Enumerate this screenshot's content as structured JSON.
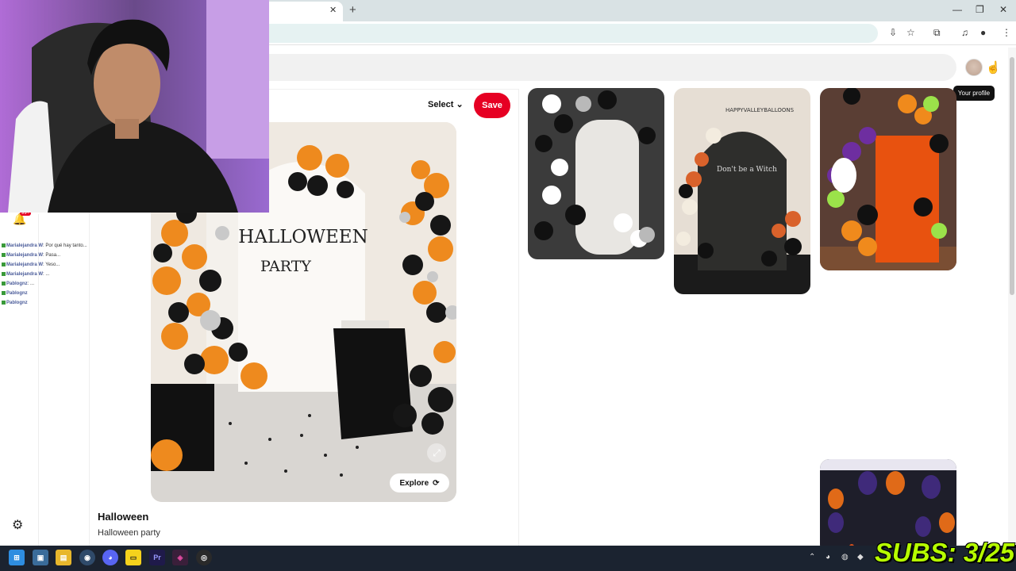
{
  "browser": {
    "tab_close_icon": "close-icon",
    "new_tab_icon": "plus-icon",
    "window_controls": [
      "minimize-icon",
      "restore-icon",
      "close-icon"
    ],
    "toolbar_icons": [
      "install-icon",
      "bookmark-star-icon",
      "extensions-icon",
      "media-icon",
      "profile-icon",
      "menu-icon"
    ]
  },
  "header": {
    "profile_tooltip": "Your profile"
  },
  "pin": {
    "select_label": "Select",
    "save_label": "Save",
    "explore_label": "Explore",
    "title": "Halloween",
    "description": "Halloween party",
    "image_text_line1": "HALLOWEEN",
    "image_text_line2": "PARTY"
  },
  "related": {
    "card2_text_brand": "HAPPYVALLEYBALLOONS",
    "card2_text_sign": "Don't be a Witch"
  },
  "sidebar": {
    "notifications_badge": "99+",
    "settings_icon": "gear-icon"
  },
  "chat": [
    {
      "user": "Marialejandra W",
      "msg": ": Por qué hay tanto..."
    },
    {
      "user": "Marialejandra W",
      "msg": ": Pasa..."
    },
    {
      "user": "Marialejandra W",
      "msg": ": Yeso..."
    },
    {
      "user": "Marialejandra W",
      "msg": ": ..."
    },
    {
      "user": "Pablognz",
      "msg": ": ..."
    },
    {
      "user": "Pablognz",
      "msg": ""
    },
    {
      "user": "Pablognz",
      "msg": ""
    }
  ],
  "overlay": {
    "subs_text": "SUBS: 3/25"
  },
  "colors": {
    "accent": "#e60023",
    "subs": "#b6ff00"
  }
}
